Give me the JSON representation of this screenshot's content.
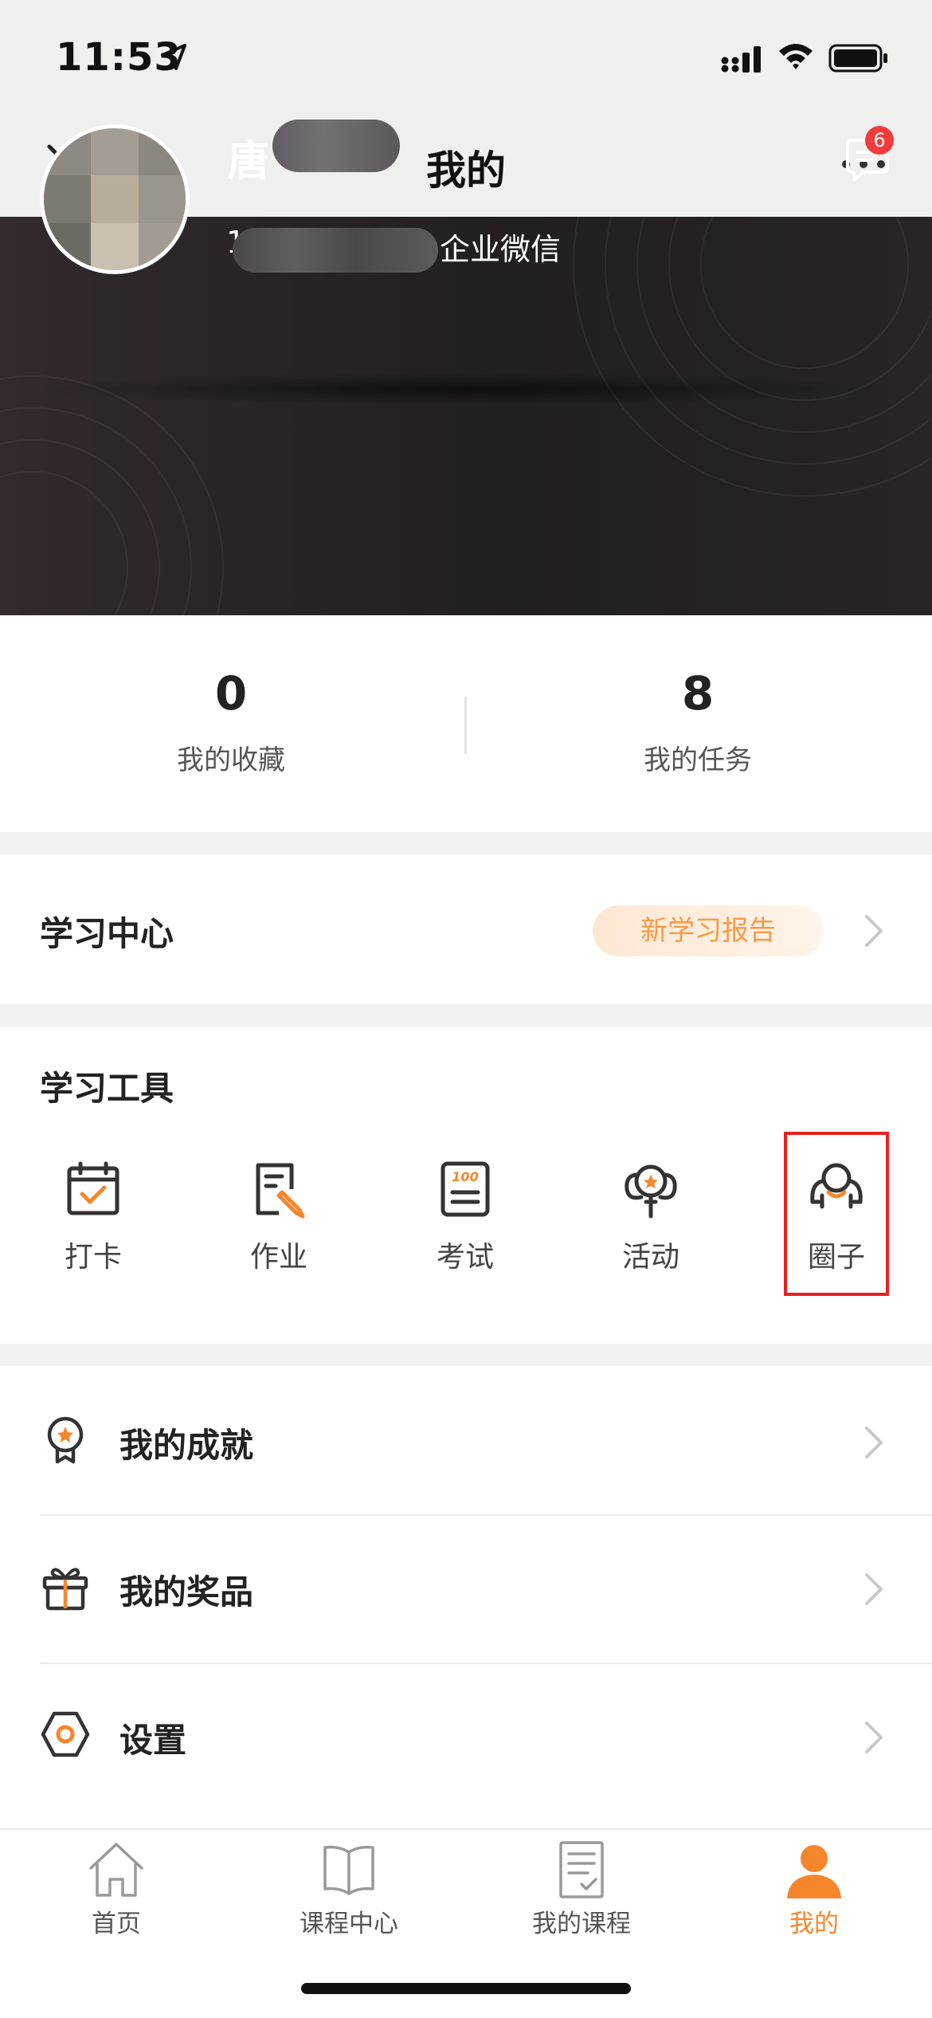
{
  "status_bar": {
    "time": "11:53"
  },
  "nav": {
    "title": "我的"
  },
  "profile": {
    "name_visible": "唐",
    "subtitle_prefix": "1",
    "subtitle_suffix": "企业微信",
    "message_badge": "6"
  },
  "stats": [
    {
      "value": "0",
      "label": "我的收藏"
    },
    {
      "value": "8",
      "label": "我的任务"
    }
  ],
  "learning_center": {
    "title": "学习中心",
    "report_label": "新学习报告"
  },
  "tools": {
    "title": "学习工具",
    "items": [
      {
        "label": "打卡",
        "icon": "calendar-check-icon"
      },
      {
        "label": "作业",
        "icon": "homework-icon"
      },
      {
        "label": "考试",
        "icon": "exam-icon"
      },
      {
        "label": "活动",
        "icon": "activity-icon"
      },
      {
        "label": "圈子",
        "icon": "circle-group-icon"
      }
    ],
    "exam_icon_text": "100"
  },
  "list": [
    {
      "label": "我的成就",
      "icon": "medal-icon"
    },
    {
      "label": "我的奖品",
      "icon": "gift-icon"
    },
    {
      "label": "设置",
      "icon": "settings-icon"
    }
  ],
  "tabbar": [
    {
      "label": "首页",
      "icon": "home-icon",
      "active": false
    },
    {
      "label": "课程中心",
      "icon": "book-icon",
      "active": false
    },
    {
      "label": "我的课程",
      "icon": "course-list-icon",
      "active": false
    },
    {
      "label": "我的",
      "icon": "person-icon",
      "active": true
    }
  ],
  "colors": {
    "accent": "#f5862c",
    "header_bg": "#231e22",
    "badge": "#f23b3b",
    "highlight_box": "#e62121"
  }
}
